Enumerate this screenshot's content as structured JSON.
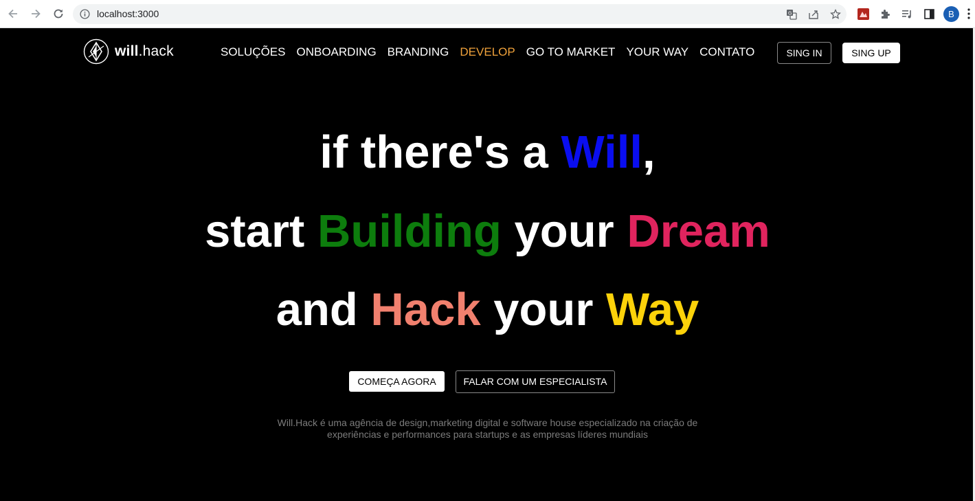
{
  "browser": {
    "url": "localhost:3000",
    "profile_initial": "B",
    "icons": [
      "back-icon",
      "forward-icon",
      "reload-icon",
      "info-icon",
      "translate-icon",
      "share-icon",
      "star-icon",
      "extension-app-icon",
      "puzzle-icon",
      "media-queue-icon",
      "side-panel-icon",
      "menu-dots-icon"
    ]
  },
  "header": {
    "logo": {
      "bold": "will",
      "rest": ".hack"
    },
    "nav": [
      {
        "label": "SOLUÇÕES"
      },
      {
        "label": "ONBOARDING"
      },
      {
        "label": "BRANDING"
      },
      {
        "label": "DEVELOP",
        "active": true
      },
      {
        "label": "GO TO MARKET"
      },
      {
        "label": "YOUR WAY"
      },
      {
        "label": "CONTATO"
      }
    ],
    "signin_label": "SING IN",
    "signup_label": "SING UP"
  },
  "hero": {
    "line1": {
      "a": "if there's a ",
      "b": "Will",
      "c": ","
    },
    "line2": {
      "a": "start ",
      "b": "Building",
      "c": " your ",
      "d": "Dream"
    },
    "line3": {
      "a": "and ",
      "b": "Hack",
      "c": " your ",
      "d": "Way"
    },
    "colors": {
      "will": "#0a0ef0",
      "building": "#0d7d0d",
      "dream": "#e0245e",
      "hack": "#f1806e",
      "way": "#fcd20a",
      "active_nav": "#f0a23b"
    },
    "cta_primary": "COMEÇA AGORA",
    "cta_secondary": "FALAR COM UM ESPECIALISTA",
    "description_line1": "Will.Hack é uma agência de design,marketing digital e software house especializado na criação de",
    "description_line2": "experiências e performances para startups e as empresas líderes mundiais"
  }
}
